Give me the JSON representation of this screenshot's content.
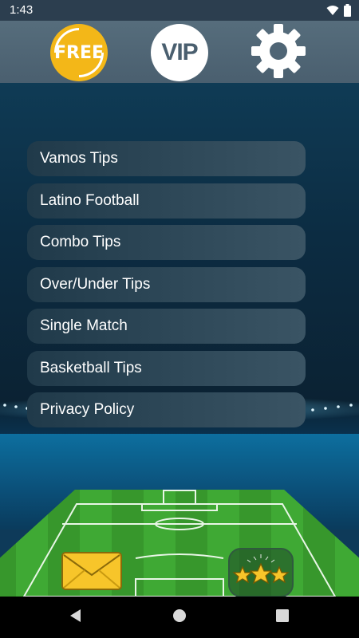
{
  "status_bar": {
    "time": "1:43"
  },
  "top_bar": {
    "free_label": "FREE",
    "vip_label": "VIP"
  },
  "menu": {
    "items": [
      {
        "label": "Vamos Tips"
      },
      {
        "label": "Latino Football"
      },
      {
        "label": "Combo Tips"
      },
      {
        "label": "Over/Under Tips"
      },
      {
        "label": "Single Match"
      },
      {
        "label": "Basketball Tips"
      },
      {
        "label": "Privacy Policy"
      }
    ]
  },
  "icons": {
    "free": "free-badge-icon",
    "vip": "vip-badge-icon",
    "settings": "gear-icon",
    "mail": "envelope-icon",
    "rate": "stars-icon",
    "wifi": "wifi-icon",
    "battery": "battery-icon",
    "back": "back-triangle-icon",
    "home": "home-circle-icon",
    "recents": "recents-square-icon"
  },
  "colors": {
    "free_badge": "#f3b718",
    "top_bar": "#566d7c",
    "menu_item": "#2e4858",
    "field_green": "#3fa934",
    "envelope": "#f7c52a"
  }
}
